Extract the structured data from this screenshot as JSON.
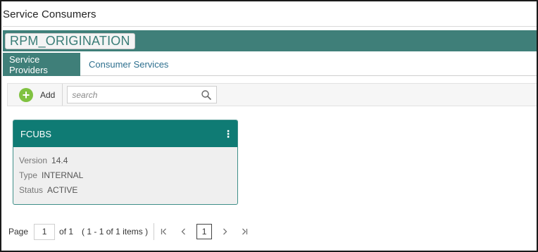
{
  "window": {
    "title": "Service Consumers"
  },
  "app": {
    "name": "RPM_ORIGINATION",
    "accent": "#3f7f79"
  },
  "tabs": [
    {
      "label": "Service Providers",
      "active": true
    },
    {
      "label": "Consumer Services",
      "active": false
    }
  ],
  "toolbar": {
    "add_label": "Add",
    "add_icon": "plus-circle-icon",
    "search_placeholder": "search",
    "search_icon": "magnifier-icon"
  },
  "cards": [
    {
      "title": "FCUBS",
      "menu_icon": "kebab-menu-icon",
      "fields": [
        {
          "key": "Version",
          "value": "14.4"
        },
        {
          "key": "Type",
          "value": "INTERNAL"
        },
        {
          "key": "Status",
          "value": "ACTIVE"
        }
      ]
    }
  ],
  "pagination": {
    "page_label": "Page",
    "page_value": "1",
    "of_label": "of 1",
    "items_label": "( 1 - 1 of 1 items )",
    "current_page": "1",
    "first_glyph": "|<",
    "prev_glyph": "<",
    "next_glyph": ">",
    "last_glyph": ">|"
  }
}
